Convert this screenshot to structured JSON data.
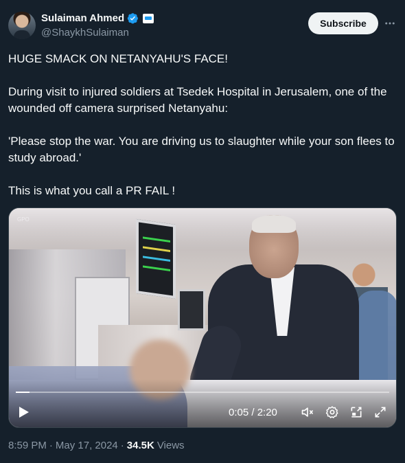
{
  "author": {
    "display_name": "Sulaiman Ahmed",
    "handle": "@ShaykhSulaiman",
    "verified": true
  },
  "actions": {
    "subscribe_label": "Subscribe",
    "more_icon": "more-horizontal-icon"
  },
  "tweet": {
    "paragraphs": [
      "HUGE SMACK ON NETANYAHU'S FACE!",
      "During visit to injured soldiers at Tsedek Hospital in Jerusalem, one of the wounded off camera surprised Netanyahu:",
      "'Please stop the war. You are driving us to slaughter while your son flees to study abroad.'",
      "This is what you call a PR FAIL !"
    ]
  },
  "video": {
    "watermark": "GPO",
    "current_time": "0:05",
    "duration": "2:20",
    "time_display": "0:05 / 2:20",
    "progress_fraction": 0.036,
    "muted": true,
    "controls": [
      "play-icon",
      "mute-icon",
      "settings-icon",
      "picture-in-picture-icon",
      "fullscreen-icon"
    ]
  },
  "meta": {
    "time": "8:59 PM",
    "separator": "·",
    "date": "May 17, 2024",
    "views_count": "34.5K",
    "views_label": "Views"
  },
  "colors": {
    "background": "#15202b",
    "text": "#f7f9f9",
    "secondary": "#8b98a5",
    "accent": "#1d9bf0"
  }
}
